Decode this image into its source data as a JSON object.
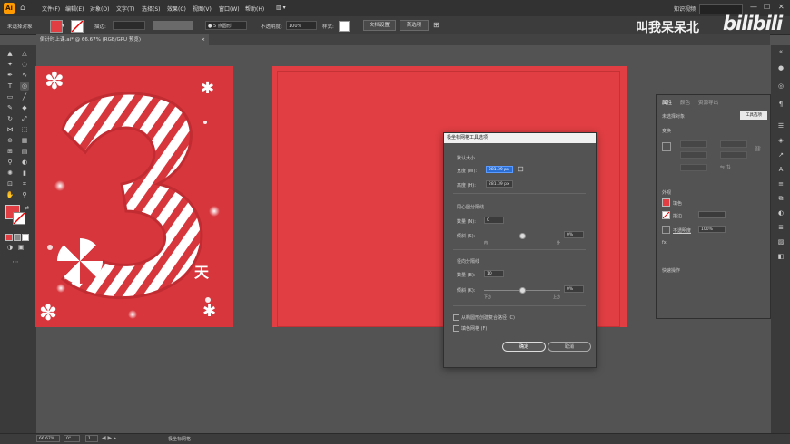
{
  "app": {
    "logo": "Ai",
    "home_icon": "home-icon"
  },
  "menu": [
    "文件(F)",
    "编辑(E)",
    "对象(O)",
    "文字(T)",
    "选择(S)",
    "效果(C)",
    "视图(V)",
    "窗口(W)",
    "帮助(H)"
  ],
  "window": {
    "workspace": "知识视频",
    "minimize": "—",
    "maximize": "☐",
    "close": "✕"
  },
  "options": {
    "selection_label": "未选择对象",
    "stroke_label": "描边:",
    "brush_value": "5 点圆形",
    "opacity_label": "不透明度:",
    "opacity_value": "100%",
    "style_label": "样式:",
    "doc_setup": "文档设置",
    "prefs": "首选项"
  },
  "document": {
    "tab": "倒计时上课.ai* @ 66.67% (RGB/GPU 预览)",
    "close": "×"
  },
  "watermark": {
    "text": "叫我呆呆北",
    "brand": "bilibili"
  },
  "artwork": {
    "number": "3",
    "unit": "天"
  },
  "status": {
    "zoom": "66.67%",
    "angle": "0°",
    "page": "1",
    "info": "极坐标网格"
  },
  "dialog": {
    "title": "极坐标网格工具选项",
    "size_section": "默认大小",
    "width_label": "宽度 (W):",
    "width_value": "281.39 px",
    "height_label": "高度 (H):",
    "height_value": "281.39 px",
    "concentric_section": "同心圆分隔线",
    "c_count_label": "数量 (N):",
    "c_count_value": "0",
    "c_skew_label": "倾斜 (S):",
    "c_skew_value": "0%",
    "c_skew_level": 0.5,
    "c_left_tick": "内",
    "c_right_tick": "外",
    "radial_section": "径向分隔线",
    "r_count_label": "数量 (B):",
    "r_count_value": "10",
    "r_skew_label": "倾斜 (K):",
    "r_skew_value": "0%",
    "r_skew_level": 0.5,
    "r_left_tick": "下方",
    "r_right_tick": "上方",
    "check_ellipse": "从椭圆形创建复合路径 (C)",
    "check_fill": "填色网格 (F)",
    "ok": "确定",
    "cancel": "取消"
  },
  "properties_panel": {
    "tabs": [
      "属性",
      "颜色",
      "资源导出"
    ],
    "no_selection": "未选择对象",
    "tool_options": "工具选项",
    "transform": "变换",
    "appearance": "外观",
    "fill_label": "填色",
    "stroke_label": "描边",
    "opacity_label": "不透明度",
    "opacity_value": "100%",
    "fx": "fx.",
    "quick_actions": "快速操作",
    "fill_color": "#e03e42"
  },
  "colors": {
    "artboard": "#e03e42",
    "accent": "#e03e42"
  }
}
